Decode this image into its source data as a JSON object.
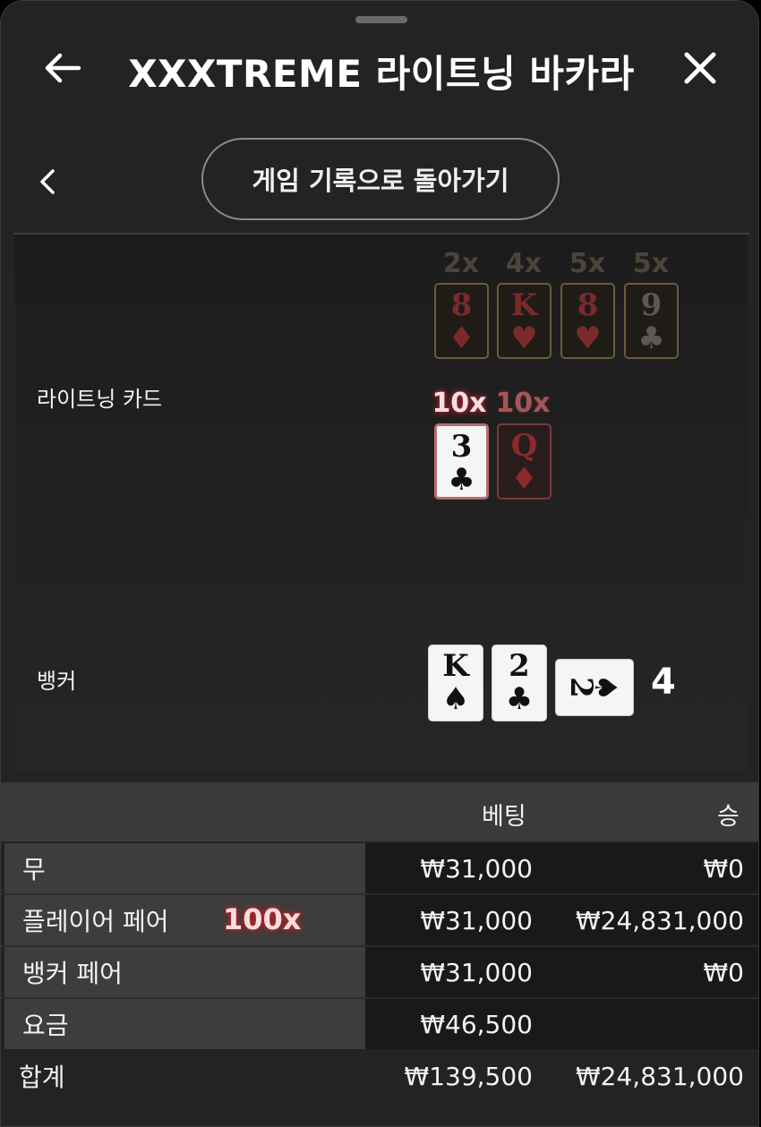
{
  "header": {
    "title": "XXXTREME 라이트닝 바카라",
    "back_icon": "arrow-left-icon",
    "close_icon": "close-icon"
  },
  "nav": {
    "prev_icon": "chevron-left-icon",
    "history_button": "게임 기록으로 돌아가기"
  },
  "lightning": {
    "label": "라이트닝 카드",
    "top_cards": [
      {
        "mult": "2x",
        "rank": "8",
        "suit": "♦",
        "color": "red"
      },
      {
        "mult": "4x",
        "rank": "K",
        "suit": "♥",
        "color": "red"
      },
      {
        "mult": "5x",
        "rank": "8",
        "suit": "♥",
        "color": "red"
      },
      {
        "mult": "5x",
        "rank": "9",
        "suit": "♣",
        "color": "black"
      }
    ],
    "hit_cards": [
      {
        "mult": "10x",
        "rank": "3",
        "suit": "♣"
      },
      {
        "mult": "10x",
        "rank": "Q",
        "suit": "♦"
      }
    ]
  },
  "banker": {
    "label": "뱅커",
    "cards": [
      {
        "rank": "K",
        "suit": "♠"
      },
      {
        "rank": "2",
        "suit": "♣"
      },
      {
        "rank": "2",
        "suit": "♠"
      }
    ],
    "score": "4"
  },
  "bets_table": {
    "headers": {
      "bet": "베팅",
      "win": "승"
    },
    "rows": [
      {
        "label": "무",
        "bet": "₩31,000",
        "win": "₩0",
        "badge": ""
      },
      {
        "label": "플레이어 페어",
        "bet": "₩31,000",
        "win": "₩24,831,000",
        "badge": "100x"
      },
      {
        "label": "뱅커 페어",
        "bet": "₩31,000",
        "win": "₩0",
        "badge": ""
      },
      {
        "label": "요금",
        "bet": "₩46,500",
        "win": "",
        "badge": ""
      }
    ],
    "total": {
      "label": "합계",
      "bet": "₩139,500",
      "win": "₩24,831,000"
    }
  }
}
